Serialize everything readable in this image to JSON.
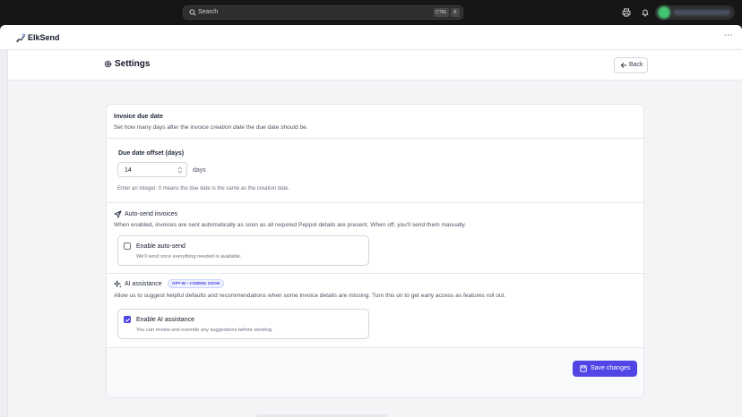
{
  "topbar": {
    "search_placeholder": "Search",
    "shortcut_ctrl": "CTRL",
    "shortcut_key": "K"
  },
  "app": {
    "title": "ElkSend",
    "more_menu": "⋯"
  },
  "header": {
    "title": "Settings",
    "back_label": "Back"
  },
  "invoice_due_date": {
    "title": "Invoice due date",
    "desc_before": "Set how many days after the invoice ",
    "desc_emphasis": "creation date",
    "desc_after": " the due date should be.",
    "field_label": "Due date offset (days)",
    "field_value": "14",
    "unit": "days",
    "hint": "Enter an integer. 0 means the due date is the same as the creation date."
  },
  "auto_send": {
    "title": "Auto-send invoices",
    "desc": "When enabled, invoices are sent automatically as soon as all required Peppol details are present. When off, you'll send them manually.",
    "option_label": "Enable auto-send",
    "option_help": "We'll send once everything needed is available.",
    "checked": false
  },
  "ai_assistance": {
    "title": "AI assistance",
    "badge": "OPT-IN • COMING SOON",
    "desc": "Allow us to suggest helpful defaults and recommendations when some invoice details are missing. Turn this on to get early access as features roll out.",
    "option_label": "Enable AI assistance",
    "option_help": "You can review and override any suggestions before sending.",
    "checked": true
  },
  "footer": {
    "save_label": "Save changes"
  },
  "colors": {
    "accent": "#4f46e5",
    "topbar": "#161616",
    "page_bg": "#f3f4f6"
  },
  "icons": {
    "search": "search-icon",
    "printer": "printer-icon",
    "bell": "bell-icon",
    "logo": "elk-logo-icon",
    "settings": "gear-icon",
    "back": "arrow-left-icon",
    "send": "send-icon",
    "ai": "sparkles-icon",
    "save": "save-icon"
  }
}
